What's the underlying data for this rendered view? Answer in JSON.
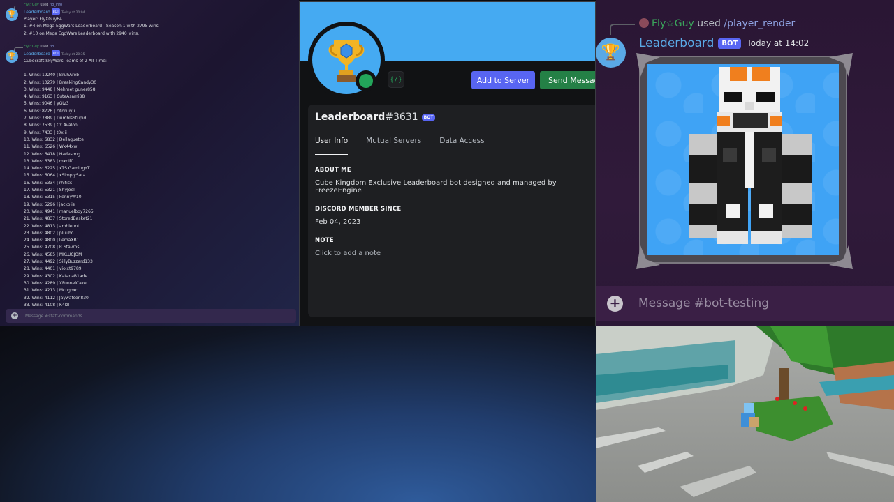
{
  "left": {
    "msg1": {
      "reply_user": "Fly☆Guy",
      "reply_used": "used",
      "reply_command": "/lb_info",
      "bot_name": "Leaderboard",
      "bot_badge": "BOT",
      "time": "Today at 20:04",
      "lines": [
        "Player: FlyXGuy64",
        "1. #4 on Mega EggWars Leaderboard - Season 1 with 2795 wins.",
        "2. #10 on Mega EggWars Leaderboard with 2940 wins."
      ]
    },
    "msg2": {
      "reply_user": "Fly☆Guy",
      "reply_used": "used",
      "reply_command": "/lb",
      "bot_name": "Leaderboard",
      "bot_badge": "BOT",
      "time": "Today at 20:35",
      "heading": "Cubecraft SkyWars Teams of 2 All Time:",
      "entries": [
        "1. Wins: 19240 | BruhAreb",
        "2. Wins: 10279 | BreakingCandy30",
        "3. Wins: 9448 | Mehmet guner858",
        "4. Wins: 9163 | CuteAsami88",
        "5. Wins: 9046 | yGtz3",
        "6. Wins: 8726 | citoruiyu",
        "7. Wins: 7889 | DumbIsStupid",
        "8. Wins: 7539 | CY Avalon",
        "9. Wins: 7433 | t0xiii",
        "10. Wins: 6832 | Dellaguette",
        "11. Wins: 6526 | Wx44xw",
        "12. Wins: 6418 | Hadesong",
        "13. Wins: 6383 | mxnil0",
        "14. Wins: 6225 | xTS GamingYT",
        "15. Wins: 6064 | xSimplySara",
        "16. Wins: 5334 | rhitics",
        "17. Wins: 5321 | ShyJoel",
        "18. Wins: 5315 | kennyW10",
        "19. Wins: 5296 | jackolis",
        "20. Wins: 4941 | manuelboy7265",
        "21. Wins: 4837 | StoredBasket21",
        "22. Wins: 4813 | ambiennt",
        "23. Wins: 4802 | pluubo",
        "24. Wins: 4800 | LemaXB1",
        "25. Wins: 4708 | R Stavros",
        "26. Wins: 4585 | MKLUCJOM",
        "27. Wins: 4492 | SillyBuzzard133",
        "28. Wins: 4401 | violxt9789",
        "29. Wins: 4302 | KatanaB1ade",
        "30. Wins: 4289 | XFunnelCake",
        "31. Wins: 4213 | Mcngoxc",
        "32. Wins: 4112 | Jaywatson830",
        "33. Wins: 4108 | K4lzl"
      ]
    },
    "input_placeholder": "Message #staff-commands"
  },
  "profile": {
    "dev_badge": "{/}",
    "add_button": "Add to Server",
    "send_button": "Send Message",
    "username": "Leaderboard",
    "discriminator": "#3631",
    "bot_badge": "BOT",
    "tabs": [
      "User Info",
      "Mutual Servers",
      "Data Access"
    ],
    "about_title": "ABOUT ME",
    "about_text": "Cube Kingdom Exclusive Leaderboard bot designed and managed by FreezeEngine",
    "member_since_title": "DISCORD MEMBER SINCE",
    "member_since": "Feb 04, 2023",
    "note_title": "NOTE",
    "note_placeholder": "Click to add a note"
  },
  "right": {
    "reply_user": "Fly☆Guy",
    "reply_used": "used",
    "reply_command": "/player_render",
    "bot_name": "Leaderboard",
    "bot_badge": "BOT",
    "time": "Today at 14:02",
    "input_placeholder": "Message #bot-testing"
  },
  "colors": {
    "blurple": "#5865f2",
    "green": "#248046",
    "online": "#23a55a",
    "bot_name": "#5aa9e6",
    "banner": "#45aaf2"
  },
  "icons": [
    "trophy-icon",
    "plus-icon",
    "online-status-icon",
    "developer-badge-icon"
  ]
}
